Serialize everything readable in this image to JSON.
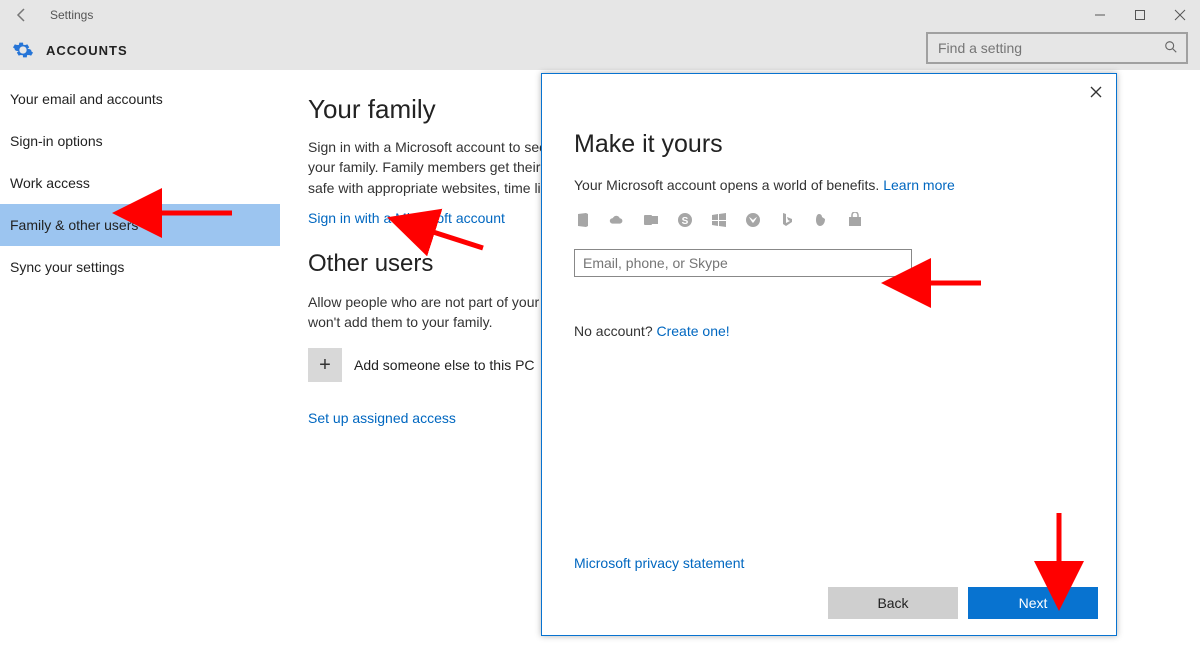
{
  "titlebar": {
    "app_title": "Settings"
  },
  "header": {
    "section_title": "ACCOUNTS",
    "search_placeholder": "Find a setting"
  },
  "sidebar": {
    "items": [
      {
        "label": "Your email and accounts",
        "selected": false
      },
      {
        "label": "Sign-in options",
        "selected": false
      },
      {
        "label": "Work access",
        "selected": false
      },
      {
        "label": "Family & other users",
        "selected": true
      },
      {
        "label": "Sync your settings",
        "selected": false
      }
    ]
  },
  "main": {
    "your_family_heading": "Your family",
    "your_family_body": "Sign in with a Microsoft account to see your family here or add any new members to your family. Family members get their own sign-in and desktop. You can help kids stay safe with appropriate websites, time limits, apps, and games.",
    "sign_in_link": "Sign in with a Microsoft account",
    "other_users_heading": "Other users",
    "other_users_body": "Allow people who are not part of your family to sign in with their own accounts. This won't add them to your family.",
    "add_label": "Add someone else to this PC",
    "assigned_access_link": "Set up assigned access"
  },
  "dialog": {
    "title": "Make it yours",
    "subtitle_pre": "Your Microsoft account opens a world of benefits. ",
    "learn_more": "Learn more",
    "input_placeholder": "Email, phone, or Skype",
    "no_account_pre": "No account? ",
    "create_one": "Create one!",
    "privacy": "Microsoft privacy statement",
    "back": "Back",
    "next": "Next"
  }
}
